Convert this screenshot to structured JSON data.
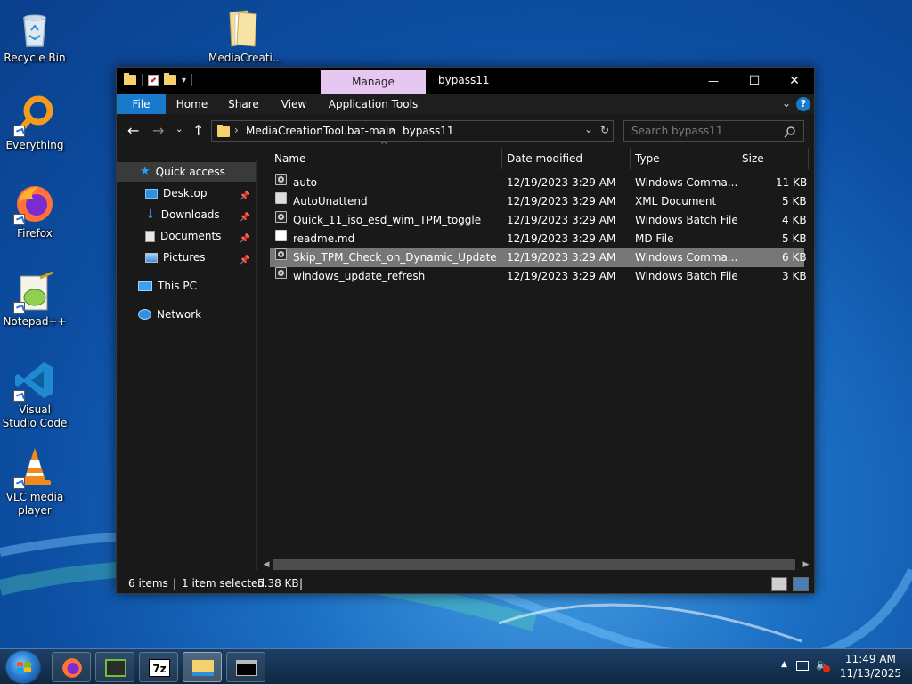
{
  "desktop": {
    "icons": [
      {
        "label": "Recycle Bin"
      },
      {
        "label": "Everything"
      },
      {
        "label": "Firefox"
      },
      {
        "label": "Notepad++"
      },
      {
        "label": "Visual Studio Code"
      },
      {
        "label": "VLC media player"
      },
      {
        "label": "MediaCreati..."
      }
    ]
  },
  "window": {
    "title": "bypass11",
    "manage_tab": "Manage",
    "controls": {
      "minimize": "—",
      "maximize": "☐",
      "close": "✕"
    },
    "ribbon_tabs": [
      "File",
      "Home",
      "Share",
      "View",
      "Application Tools"
    ],
    "address": {
      "crumbs": [
        "MediaCreationTool.bat-main",
        "bypass11"
      ]
    },
    "search": {
      "placeholder": "Search bypass11"
    },
    "nav": {
      "quick_access": "Quick access",
      "desktop": "Desktop",
      "downloads": "Downloads",
      "documents": "Documents",
      "pictures": "Pictures",
      "this_pc": "This PC",
      "network": "Network"
    },
    "columns": {
      "name": "Name",
      "date": "Date modified",
      "type": "Type",
      "size": "Size"
    },
    "files": [
      {
        "name": "auto",
        "date": "12/19/2023 3:29 AM",
        "type": "Windows Comma...",
        "size": "11 KB"
      },
      {
        "name": "AutoUnattend",
        "date": "12/19/2023 3:29 AM",
        "type": "XML Document",
        "size": "5 KB"
      },
      {
        "name": "Quick_11_iso_esd_wim_TPM_toggle",
        "date": "12/19/2023 3:29 AM",
        "type": "Windows Batch File",
        "size": "4 KB"
      },
      {
        "name": "readme.md",
        "date": "12/19/2023 3:29 AM",
        "type": "MD File",
        "size": "5 KB"
      },
      {
        "name": "Skip_TPM_Check_on_Dynamic_Update",
        "date": "12/19/2023 3:29 AM",
        "type": "Windows Comma...",
        "size": "6 KB"
      },
      {
        "name": "windows_update_refresh",
        "date": "12/19/2023 3:29 AM",
        "type": "Windows Batch File",
        "size": "3 KB"
      }
    ],
    "status": {
      "items": "6 items",
      "selected": "1 item selected",
      "size": "5.38 KB"
    }
  },
  "taskbar": {
    "clock_time": "11:49 AM",
    "clock_date": "11/13/2025",
    "seven_zip_label": "7z"
  },
  "colors": {
    "accent": "#1979ca",
    "manage": "#e6c7f2",
    "selected_row": "#777777"
  }
}
